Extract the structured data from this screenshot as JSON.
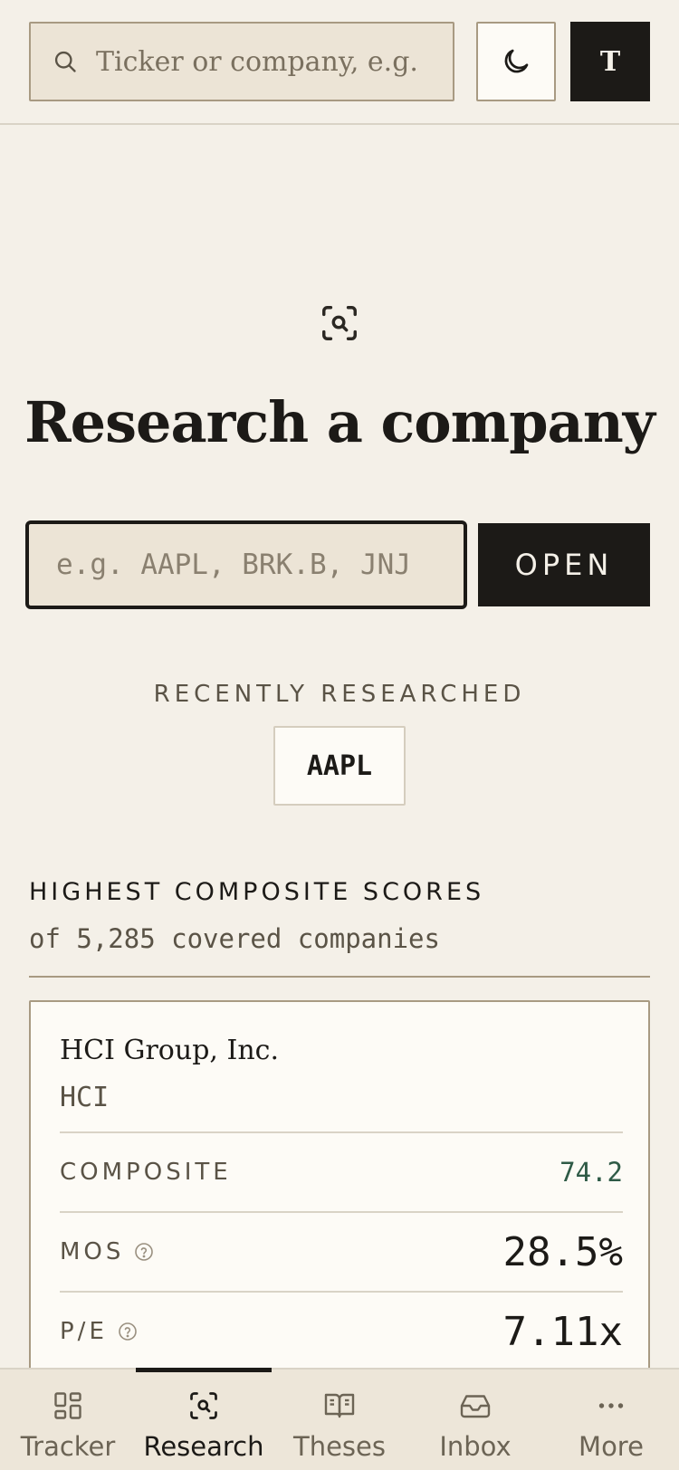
{
  "header": {
    "search_placeholder": "Ticker or company, e.g. AAPL",
    "avatar_initial": "T"
  },
  "hero": {
    "title": "Research a company",
    "ticker_placeholder": "e.g. AAPL, BRK.B, JNJ",
    "open_label": "OPEN"
  },
  "recent": {
    "label": "RECENTLY RESEARCHED",
    "items": [
      "AAPL"
    ]
  },
  "scores": {
    "title": "HIGHEST COMPOSITE SCORES",
    "subtitle": "of 5,285 covered companies",
    "cards": [
      {
        "name": "HCI Group, Inc.",
        "ticker": "HCI",
        "metrics": [
          {
            "label": "COMPOSITE",
            "value": "74.2"
          },
          {
            "label": "MOS",
            "value": "28.5%"
          },
          {
            "label": "P/E",
            "value": "7.11x"
          }
        ]
      }
    ]
  },
  "nav": {
    "items": [
      {
        "label": "Tracker",
        "icon": "grid-icon"
      },
      {
        "label": "Research",
        "icon": "scan-search-icon"
      },
      {
        "label": "Theses",
        "icon": "book-icon"
      },
      {
        "label": "Inbox",
        "icon": "inbox-icon"
      },
      {
        "label": "More",
        "icon": "more-dots-icon"
      }
    ],
    "active": "Research"
  },
  "colors": {
    "background": "#f4f0e8",
    "ink": "#1c1a17",
    "composite_accent": "#2e5a46"
  }
}
